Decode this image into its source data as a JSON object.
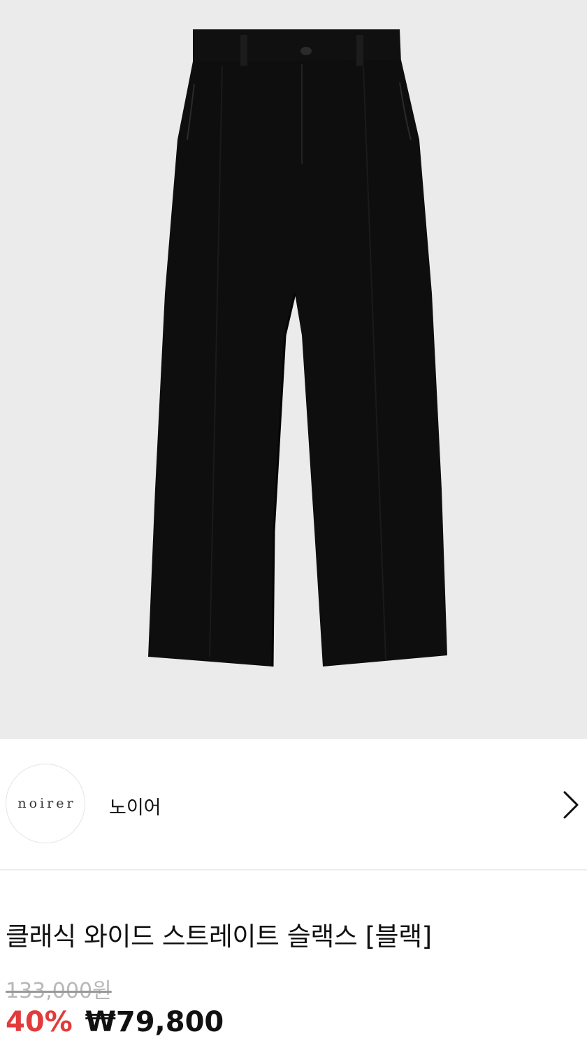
{
  "product": {
    "image_name": "product-image-black-slacks",
    "title": "클래식 와이드 스트레이트 슬랙스 [블랙]",
    "original_price": "133,000원",
    "discount": "40%",
    "sale_price": "₩79,800"
  },
  "brand": {
    "logo_text": "noirer",
    "name": "노이어",
    "chevron_icon": "chevron-right-icon"
  },
  "colors": {
    "image_background": "#ebebeb",
    "discount": "#e23b3b",
    "original_price": "#b8b8b8",
    "garment": "#0e0e0e"
  }
}
